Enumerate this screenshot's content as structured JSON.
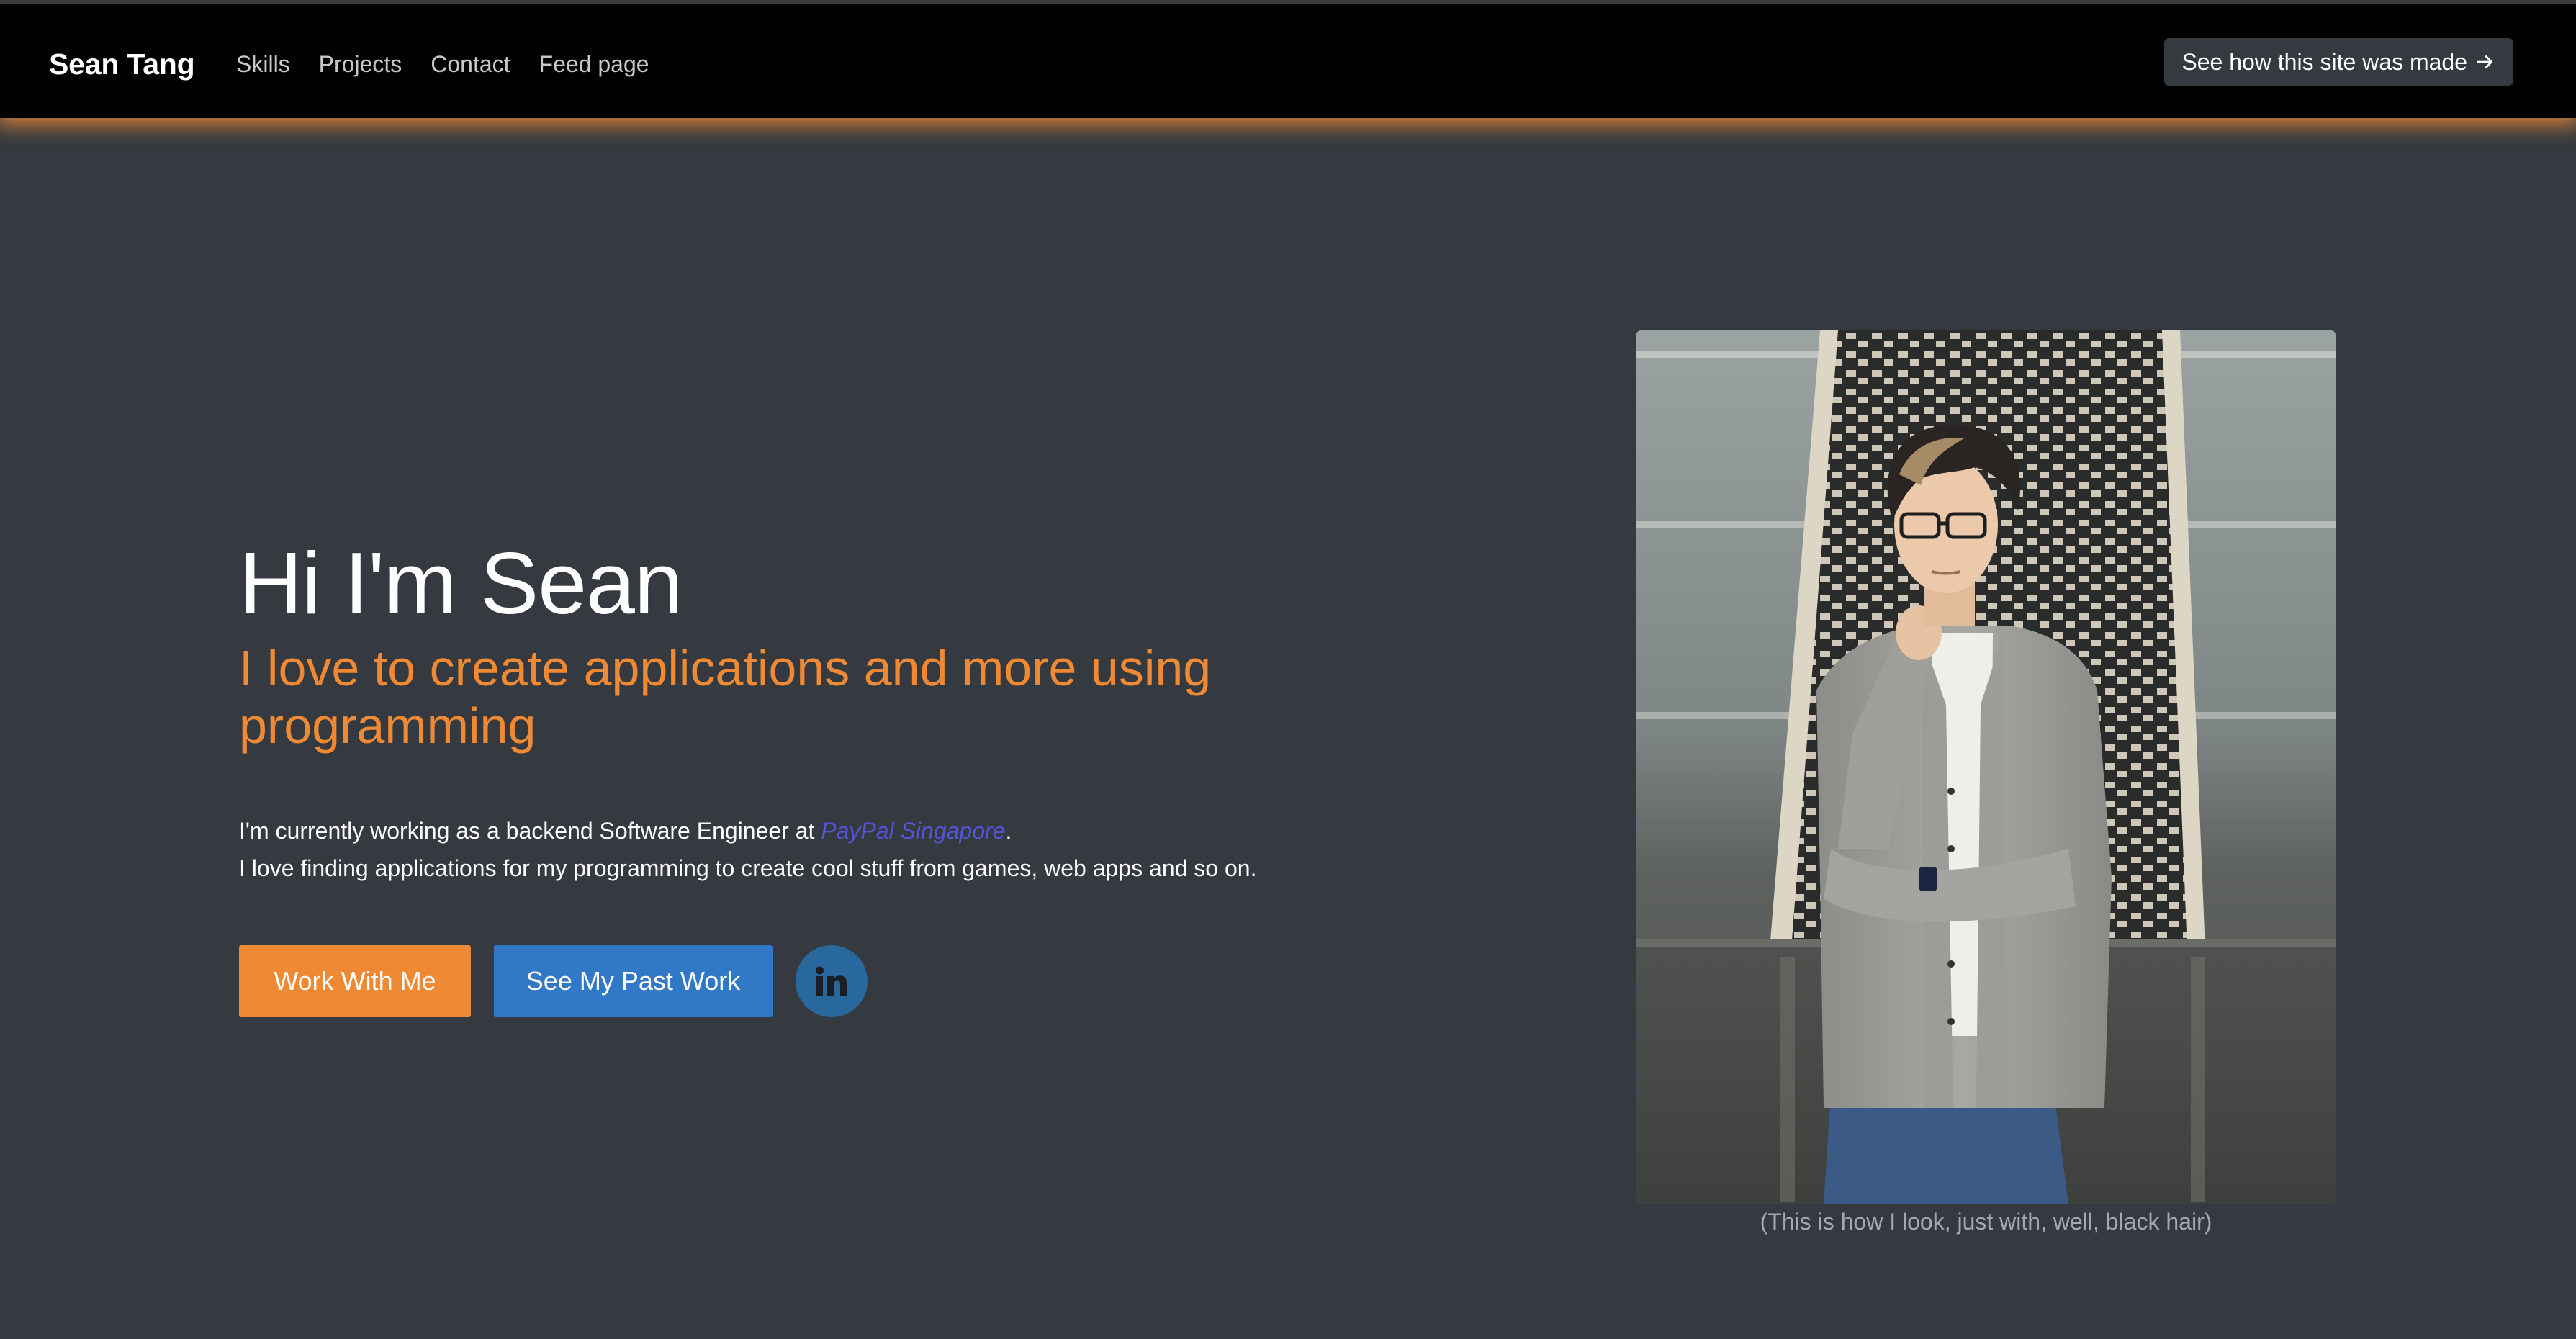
{
  "navbar": {
    "brand": "Sean Tang",
    "links": [
      {
        "label": "Skills"
      },
      {
        "label": "Projects"
      },
      {
        "label": "Contact"
      },
      {
        "label": "Feed page"
      }
    ],
    "made_button_label": "See how this site was made",
    "made_button_icon": "arrow-right-icon"
  },
  "hero": {
    "title": "Hi I'm Sean",
    "subtitle": "I love to create applications and more using programming",
    "line1_prefix": "I'm currently working as a backend Software Engineer at ",
    "line1_link": "PayPal Singapore",
    "line1_suffix": ".",
    "line2": "I love finding applications for my programming to create cool stuff from games, web apps and so on.",
    "buttons": {
      "work_with_me": "Work With Me",
      "past_work": "See My Past Work",
      "linkedin_icon": "linkedin-icon"
    }
  },
  "photo": {
    "caption": "(This is how I look, just with, well, black hair)"
  },
  "colors": {
    "accent": "#f08934",
    "primary": "#3178c6",
    "background": "#343a40",
    "navbar": "#000000",
    "link": "#5255d9",
    "linkedin": "#28689c"
  }
}
